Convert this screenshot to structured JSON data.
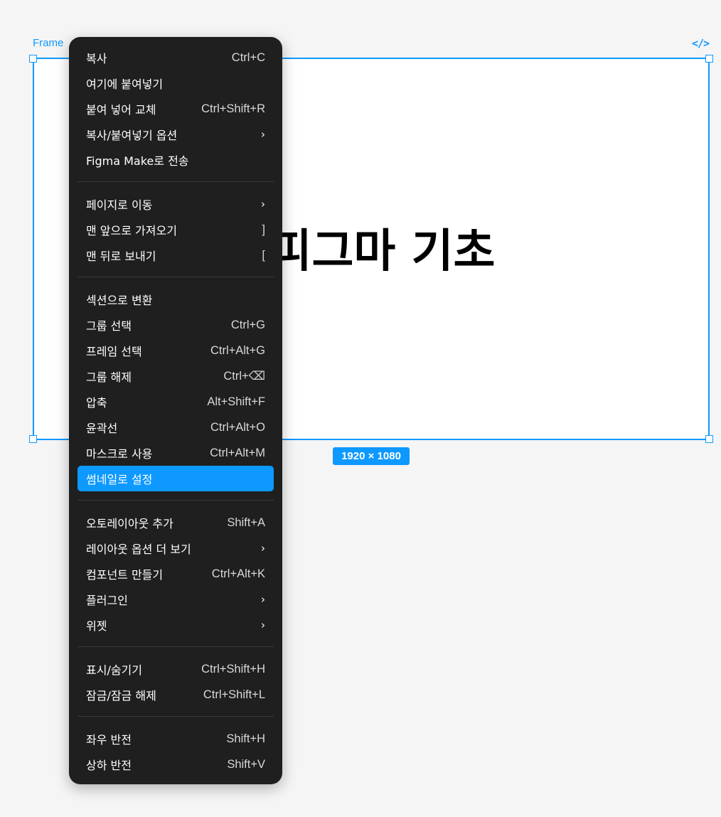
{
  "canvas": {
    "frame_label": "Frame",
    "code_icon": "</>",
    "frame_title": "피그마 기초",
    "size_badge": "1920 × 1080",
    "accent_color": "#0d99ff"
  },
  "menu": {
    "groups": [
      [
        {
          "label": "복사",
          "shortcut": "Ctrl+C"
        },
        {
          "label": "여기에 붙여넣기",
          "shortcut": ""
        },
        {
          "label": "붙여 넣어 교체",
          "shortcut": "Ctrl+Shift+R"
        },
        {
          "label": "복사/붙여넣기 옵션",
          "shortcut": "›"
        },
        {
          "label": "Figma Make로 전송",
          "shortcut": ""
        }
      ],
      [
        {
          "label": "페이지로 이동",
          "shortcut": "›"
        },
        {
          "label": "맨 앞으로 가져오기",
          "shortcut": "]"
        },
        {
          "label": "맨 뒤로 보내기",
          "shortcut": "["
        }
      ],
      [
        {
          "label": "섹션으로 변환",
          "shortcut": ""
        },
        {
          "label": "그룹 선택",
          "shortcut": "Ctrl+G"
        },
        {
          "label": "프레임 선택",
          "shortcut": "Ctrl+Alt+G"
        },
        {
          "label": "그룹 해제",
          "shortcut": "Ctrl+⌫"
        },
        {
          "label": "압축",
          "shortcut": "Alt+Shift+F"
        },
        {
          "label": "윤곽선",
          "shortcut": "Ctrl+Alt+O"
        },
        {
          "label": "마스크로 사용",
          "shortcut": "Ctrl+Alt+M"
        },
        {
          "label": "썸네일로 설정",
          "shortcut": "",
          "highlighted": true
        }
      ],
      [
        {
          "label": "오토레이아웃 추가",
          "shortcut": "Shift+A"
        },
        {
          "label": "레이아웃 옵션 더 보기",
          "shortcut": "›"
        },
        {
          "label": "컴포넌트 만들기",
          "shortcut": "Ctrl+Alt+K"
        },
        {
          "label": "플러그인",
          "shortcut": "›"
        },
        {
          "label": "위젯",
          "shortcut": "›"
        }
      ],
      [
        {
          "label": "표시/숨기기",
          "shortcut": "Ctrl+Shift+H"
        },
        {
          "label": "잠금/잠금 해제",
          "shortcut": "Ctrl+Shift+L"
        }
      ],
      [
        {
          "label": "좌우 반전",
          "shortcut": "Shift+H"
        },
        {
          "label": "상하 반전",
          "shortcut": "Shift+V"
        }
      ]
    ]
  }
}
